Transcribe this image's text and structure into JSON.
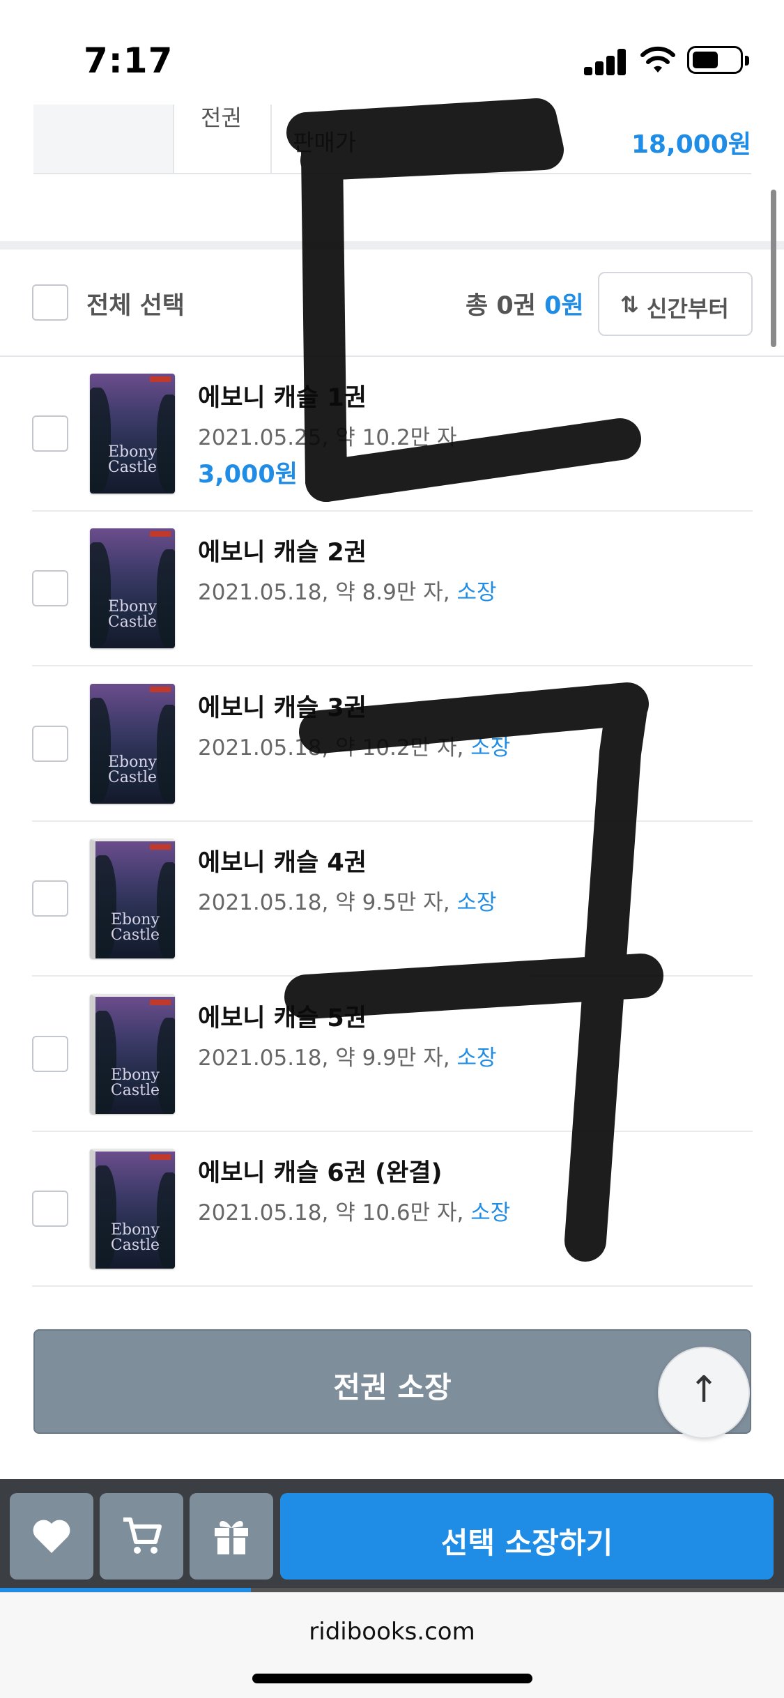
{
  "status": {
    "time": "7:17"
  },
  "price_row": {
    "cell": "전권",
    "label": "판매가",
    "value": "18,000원"
  },
  "select_all": {
    "label": "전체 선택",
    "total_prefix": "총 0권",
    "total_amount": "0원",
    "sort_label": "신간부터"
  },
  "books": [
    {
      "title": "에보니 캐슬 1권",
      "meta": "2021.05.25, 약 10.2만 자",
      "owned": "",
      "price": "3,000원",
      "cover_title_1": "Ebony",
      "cover_title_2": "Castle"
    },
    {
      "title": "에보니 캐슬 2권",
      "meta": "2021.05.18, 약 8.9만 자, ",
      "owned": "소장",
      "price": "",
      "cover_title_1": "Ebony",
      "cover_title_2": "Castle"
    },
    {
      "title": "에보니 캐슬 3권",
      "meta": "2021.05.18, 약 10.2만 자, ",
      "owned": "소장",
      "price": "",
      "cover_title_1": "Ebony",
      "cover_title_2": "Castle"
    },
    {
      "title": "에보니 캐슬 4권",
      "meta": "2021.05.18, 약 9.5만 자, ",
      "owned": "소장",
      "price": "",
      "cover_title_1": "Ebony",
      "cover_title_2": "Castle"
    },
    {
      "title": "에보니 캐슬 5권",
      "meta": "2021.05.18, 약 9.9만 자, ",
      "owned": "소장",
      "price": "",
      "cover_title_1": "Ebony",
      "cover_title_2": "Castle"
    },
    {
      "title": "에보니 캐슬 6권 (완결)",
      "meta": "2021.05.18, 약 10.6만 자, ",
      "owned": "소장",
      "price": "",
      "cover_title_1": "Ebony",
      "cover_title_2": "Castle"
    }
  ],
  "own_all_button": "전권 소장",
  "action_bar": {
    "icons": [
      "heart-icon",
      "cart-icon",
      "gift-icon"
    ],
    "buy_label": "선택 소장하기"
  },
  "progress": {
    "fraction": 0.32
  },
  "browser": {
    "url": "ridibooks.com"
  },
  "colors": {
    "accent": "#1f8ce6",
    "muted_button": "#7f8e9b"
  }
}
